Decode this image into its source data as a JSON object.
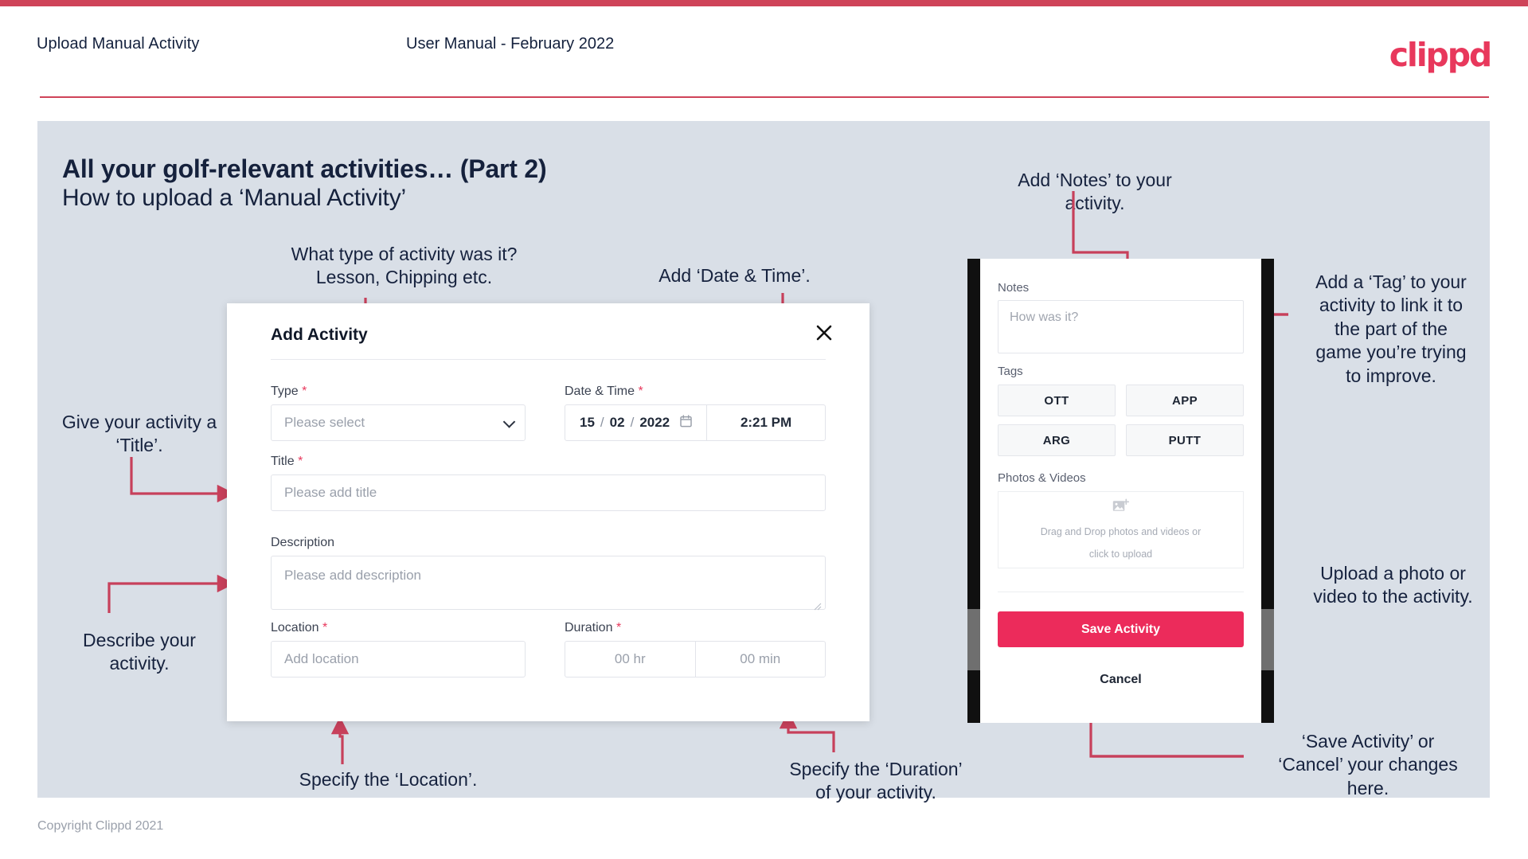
{
  "header": {
    "title": "Upload Manual Activity",
    "subtitle": "User Manual - February 2022",
    "logo": "clippd"
  },
  "slide": {
    "heading": "All your golf-relevant activities… (Part 2)",
    "subheading": "How to upload a ‘Manual Activity’"
  },
  "annotations": {
    "type": "What type of activity was it?\nLesson, Chipping etc.",
    "datetime": "Add ‘Date & Time’.",
    "title": "Give your activity a\n‘Title’.",
    "description": "Describe your\nactivity.",
    "location": "Specify the ‘Location’.",
    "duration": "Specify the ‘Duration’\nof your activity.",
    "notes": "Add ‘Notes’ to your\nactivity.",
    "tags": "Add a ‘Tag’ to your\nactivity to link it to\nthe part of the\ngame you’re trying\nto improve.",
    "photos": "Upload a photo or\nvideo to the activity.",
    "save": "‘Save Activity’ or\n‘Cancel’ your changes\nhere."
  },
  "dialog": {
    "title": "Add Activity",
    "close_icon": "close-icon",
    "fields": {
      "type": {
        "label": "Type",
        "required": "*",
        "placeholder": "Please select",
        "chevron_icon": "chevron-down-icon"
      },
      "datetime": {
        "label": "Date & Time",
        "required": "*",
        "day": "15",
        "month": "02",
        "year": "2022",
        "sep": "/",
        "calendar_icon": "calendar-icon",
        "time": "2:21 PM"
      },
      "title": {
        "label": "Title",
        "required": "*",
        "placeholder": "Please add title"
      },
      "description": {
        "label": "Description",
        "placeholder": "Please add description"
      },
      "location": {
        "label": "Location",
        "required": "*",
        "placeholder": "Add location"
      },
      "duration": {
        "label": "Duration",
        "required": "*",
        "hours_placeholder": "00 hr",
        "minutes_placeholder": "00 min"
      }
    }
  },
  "phone": {
    "notes": {
      "label": "Notes",
      "placeholder": "How was it?"
    },
    "tags": {
      "label": "Tags",
      "items": [
        "OTT",
        "APP",
        "ARG",
        "PUTT"
      ]
    },
    "photos": {
      "label": "Photos & Videos",
      "icon": "add-image-icon",
      "dropzone_line1": "Drag and Drop photos and videos or",
      "dropzone_line2": "click to upload"
    },
    "save_label": "Save Activity",
    "cancel_label": "Cancel"
  },
  "footer": {
    "copyright": "Copyright Clippd 2021"
  },
  "colors": {
    "brand_pink": "#e8385c",
    "save_pink": "#ec2b5b",
    "panel_bg": "#d9dfe7",
    "ink": "#15213c",
    "annotation_arrow": "#c7405b"
  }
}
